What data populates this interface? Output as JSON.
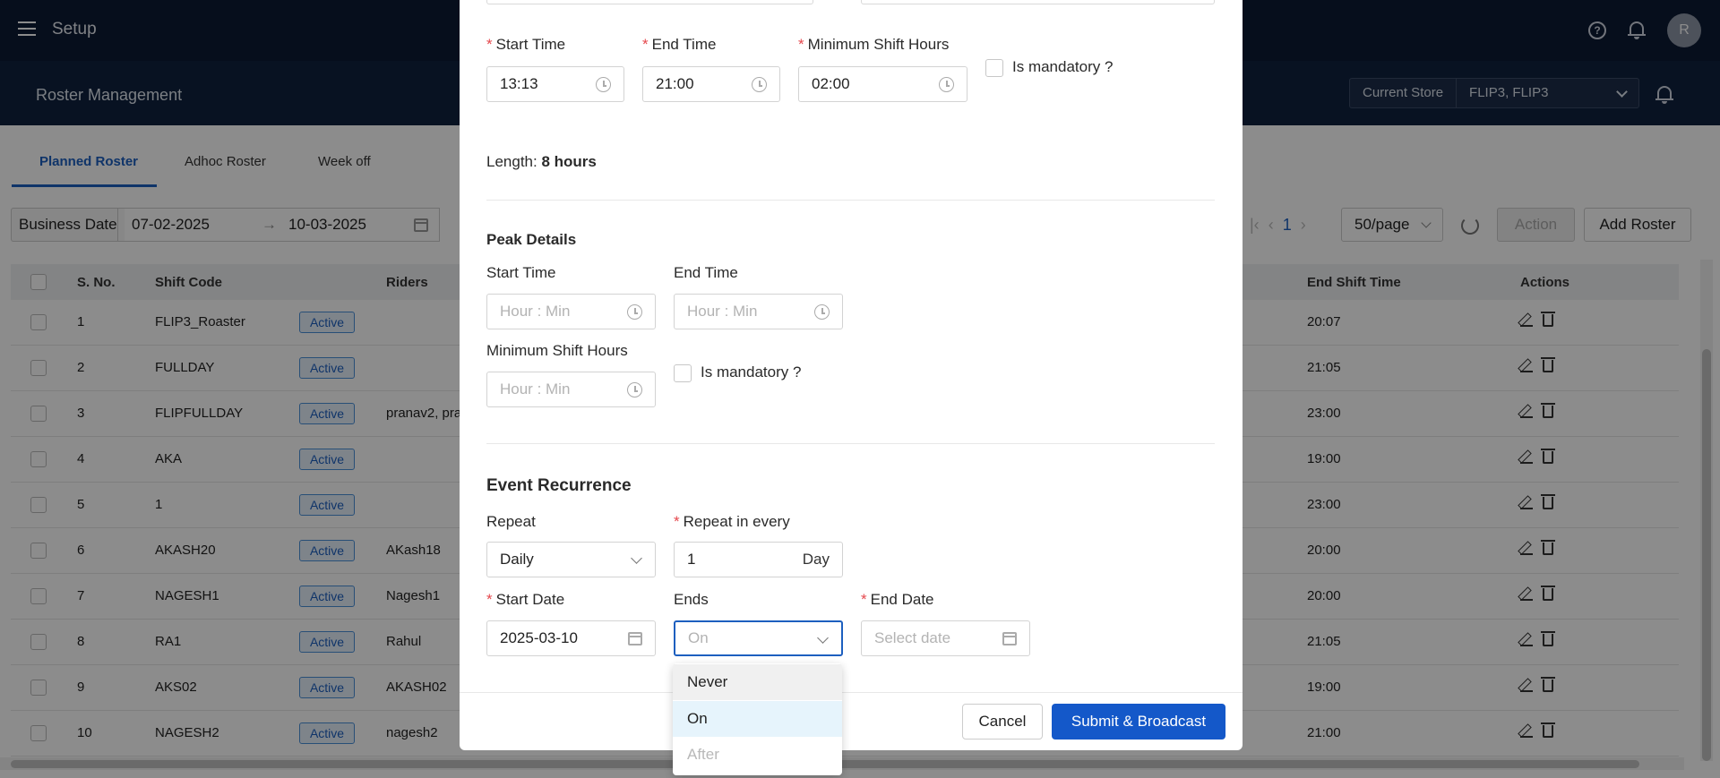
{
  "app": {
    "title": "Setup",
    "avatar_initial": "R"
  },
  "header": {
    "title": "Roster Management",
    "store_label": "Current Store",
    "store_value": "FLIP3, FLIP3"
  },
  "tabs": [
    {
      "label": "Planned Roster",
      "active": true
    },
    {
      "label": "Adhoc Roster",
      "active": false
    },
    {
      "label": "Week off",
      "active": false
    }
  ],
  "filters": {
    "business_date_label": "Business Date",
    "date_from": "07-02-2025",
    "date_to": "10-03-2025",
    "page_number": "1",
    "per_page": "50/page",
    "action_label": "Action",
    "add_label": "Add Roster"
  },
  "table": {
    "columns": [
      "S. No.",
      "Shift Code",
      "Riders",
      "End Shift Time",
      "Actions"
    ],
    "rows": [
      {
        "sno": "1",
        "code": "FLIP3_Roaster",
        "status": "Active",
        "riders": "",
        "end": "20:07"
      },
      {
        "sno": "2",
        "code": "FULLDAY",
        "status": "Active",
        "riders": "",
        "end": "21:05"
      },
      {
        "sno": "3",
        "code": "FLIPFULLDAY",
        "status": "Active",
        "riders": "pranav2, pra",
        "end": "23:00"
      },
      {
        "sno": "4",
        "code": "AKA",
        "status": "Active",
        "riders": "",
        "end": "19:00"
      },
      {
        "sno": "5",
        "code": "1",
        "status": "Active",
        "riders": "",
        "end": "23:00"
      },
      {
        "sno": "6",
        "code": "AKASH20",
        "status": "Active",
        "riders": "AKash18",
        "end": "20:00"
      },
      {
        "sno": "7",
        "code": "NAGESH1",
        "status": "Active",
        "riders": "Nagesh1",
        "end": "20:00"
      },
      {
        "sno": "8",
        "code": "RA1",
        "status": "Active",
        "riders": "Rahul",
        "end": "21:05"
      },
      {
        "sno": "9",
        "code": "AKS02",
        "status": "Active",
        "riders": "AKASH02",
        "end": "19:00"
      },
      {
        "sno": "10",
        "code": "NAGESH2",
        "status": "Active",
        "riders": "nagesh2",
        "end": "21:00"
      }
    ]
  },
  "modal": {
    "shift": {
      "start_time_label": "Start Time",
      "start_time": "13:13",
      "end_time_label": "End Time",
      "end_time": "21:00",
      "min_hours_label": "Minimum Shift Hours",
      "min_hours": "02:00",
      "mandatory_label": "Is mandatory ?",
      "length_label": "Length:",
      "length_value": "8 hours"
    },
    "peak": {
      "title": "Peak Details",
      "start_time_label": "Start Time",
      "end_time_label": "End Time",
      "min_hours_label": "Minimum Shift Hours",
      "time_placeholder": "Hour : Min",
      "mandatory_label": "Is mandatory ?"
    },
    "recurrence": {
      "title": "Event Recurrence",
      "repeat_label": "Repeat",
      "repeat_value": "Daily",
      "repeat_every_label": "Repeat in every",
      "repeat_every_value": "1",
      "repeat_every_unit": "Day",
      "start_date_label": "Start Date",
      "start_date": "2025-03-10",
      "ends_label": "Ends",
      "ends_value": "On",
      "end_date_label": "End Date",
      "end_date_placeholder": "Select date"
    },
    "cancel_label": "Cancel",
    "submit_label": "Submit & Broadcast"
  },
  "ends_dropdown": {
    "options": [
      {
        "label": "Never",
        "state": "hover"
      },
      {
        "label": "On",
        "state": "selected"
      },
      {
        "label": "After",
        "state": "disabled"
      }
    ]
  },
  "colors": {
    "primary": "#1458c9",
    "header_bg": "#0c1a33",
    "required": "#e5484d"
  }
}
